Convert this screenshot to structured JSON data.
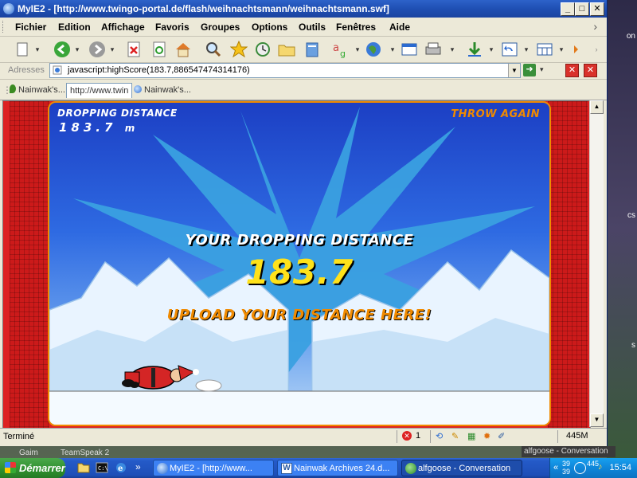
{
  "window": {
    "title": "MyIE2 - [http://www.twingo-portal.de/flash/weihnachtsmann/weihnachtsmann.swf]",
    "minimize": "_",
    "maximize": "□",
    "close": "✕"
  },
  "menu": [
    "Fichier",
    "Edition",
    "Affichage",
    "Favoris",
    "Groupes",
    "Options",
    "Outils",
    "Fenêtres",
    "Aide"
  ],
  "address": {
    "label": "Adresses",
    "value": "javascript:highScore(183.7,886547474314176)"
  },
  "tabs": [
    {
      "label": "Nainwak's...",
      "icon": "leaf-icon"
    },
    {
      "label": "http://www.twin",
      "icon": "ie-icon"
    },
    {
      "label": "Nainwak's...",
      "icon": "ie-icon"
    }
  ],
  "game": {
    "hud_label": "DROPPING DISTANCE",
    "hud_value": "183.7",
    "hud_unit": "m",
    "throw_again": "THROW AGAIN",
    "headline": "YOUR DROPPING DISTANCE",
    "distance": "183.7",
    "upload": "UPLOAD YOUR DISTANCE HERE!",
    "colors": {
      "sky_top": "#1c3fc4",
      "burst": "#3aa0e0",
      "gold": "#ffe21a",
      "orange": "#f08a00",
      "red": "#cc1a1a"
    }
  },
  "status": {
    "text": "Terminé",
    "errors": "1",
    "memory": "445M"
  },
  "desktop_labels": {
    "gaim": "Gaim",
    "teamspeak": "TeamSpeak 2",
    "tooltip": "alfgoose - Conversation",
    "right_cs": "cs",
    "right_on": "on",
    "right_s": "s"
  },
  "taskbar": {
    "start": "Démarrer",
    "buttons": [
      {
        "label": "MyIE2 - [http://www...",
        "icon": "ie-icon",
        "active": false
      },
      {
        "label": "Nainwak Archives 24.d...",
        "icon": "word-icon",
        "active": false
      },
      {
        "label": "alfgoose - Conversation",
        "icon": "msn-icon",
        "active": true
      }
    ],
    "tray_count": "445",
    "tray_small": "39",
    "clock": "15:54"
  }
}
